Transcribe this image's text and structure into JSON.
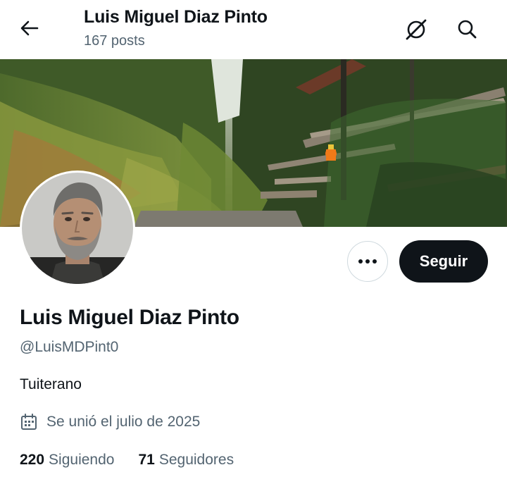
{
  "header": {
    "title": "Luis Miguel Diaz Pinto",
    "posts_count": "167 posts"
  },
  "icons": {
    "back": "arrow-left-icon",
    "grok": "grok-icon",
    "search": "search-icon",
    "more": "more-dots-icon",
    "calendar": "calendar-icon"
  },
  "profile": {
    "name": "Luis Miguel Diaz Pinto",
    "handle": "@LuisMDPint0",
    "bio": "Tuiterano",
    "joined": "Se unió el julio de 2025",
    "follow_label": "Seguir",
    "following_count": "220",
    "following_label": "Siguiendo",
    "followers_count": "71",
    "followers_label": "Seguidores"
  },
  "colors": {
    "text_primary": "#0f1419",
    "text_secondary": "#536471",
    "button_dark": "#0f1419",
    "border": "#cfd9de"
  }
}
